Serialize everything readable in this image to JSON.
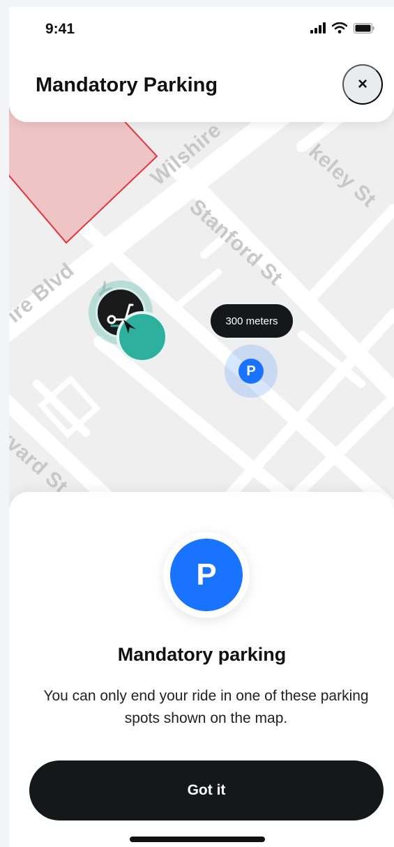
{
  "status_bar": {
    "time": "9:41"
  },
  "header": {
    "title": "Mandatory Parking",
    "close_glyph": "×"
  },
  "map": {
    "streets": [
      "Wilshire",
      "keley St",
      "Stanford St",
      "ire Blvd",
      "Y",
      "rvard St"
    ],
    "distance_label": "300 meters",
    "parking_marker_glyph": "P"
  },
  "sheet": {
    "icon_glyph": "P",
    "title": "Mandatory parking",
    "body": "You can only end your ride in one of these parking spots shown on the map.",
    "button_label": "Got it"
  },
  "colors": {
    "accent_blue": "#1a73ff",
    "accent_teal": "#2db19e",
    "zone_fill": "#efc4c4",
    "zone_stroke": "#e0353b",
    "dark": "#141818"
  },
  "icons": [
    "cellular-signal-icon",
    "wifi-icon",
    "battery-icon",
    "close-icon",
    "scooter-icon",
    "navigation-arrow-icon",
    "parking-icon"
  ]
}
